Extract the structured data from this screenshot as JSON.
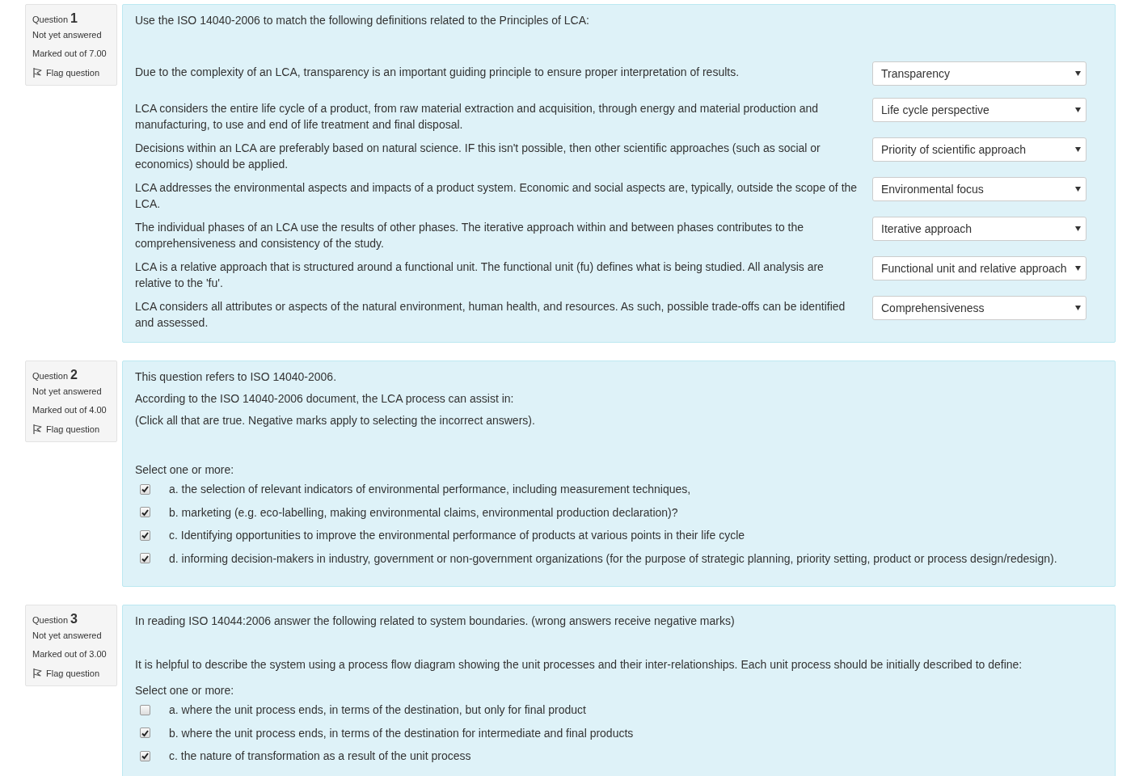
{
  "questions": [
    {
      "label": "Question",
      "number": "1",
      "status": "Not yet answered",
      "marks": "Marked out of 7.00",
      "flag": "Flag question",
      "kind": "match",
      "prompt": [
        "Use the ISO 14040-2006 to match the following definitions related to the Principles of LCA:"
      ],
      "rows": [
        {
          "text": "Due to the complexity of an LCA, transparency is an important guiding principle to ensure proper interpretation of results.",
          "answer": "Transparency"
        },
        {
          "text": "LCA considers the entire life cycle of a product, from raw material extraction and acquisition, through energy and material production and manufacturing, to use and end of life treatment and final disposal.",
          "answer": "Life cycle perspective"
        },
        {
          "text": "Decisions within an LCA are preferably based on natural science. IF this isn't possible, then other scientific approaches (such as social or economics) should be applied.",
          "answer": "Priority of scientific approach"
        },
        {
          "text": "LCA addresses the environmental aspects and impacts of a product system. Economic and social aspects are, typically, outside the scope of the LCA.",
          "answer": "Environmental focus"
        },
        {
          "text": "The individual phases of an LCA use the results of other phases. The iterative approach within and between phases contributes to the comprehensiveness and consistency of the study.",
          "answer": "Iterative approach"
        },
        {
          "text": "LCA is a relative approach that is structured around a functional unit. The functional unit (fu) defines what is being studied. All analysis are relative to the 'fu'.",
          "answer": "Functional unit and relative approach"
        },
        {
          "text": "LCA considers all attributes or aspects of the natural environment, human health, and resources. As such, possible trade-offs can be identified and assessed.",
          "answer": "Comprehensiveness"
        }
      ]
    },
    {
      "label": "Question",
      "number": "2",
      "status": "Not yet answered",
      "marks": "Marked out of 4.00",
      "flag": "Flag question",
      "kind": "multi",
      "prompt": [
        "This question refers to ISO 14040-2006.",
        "According to the ISO 14040-2006 document, the LCA process can assist in:",
        "(Click all that are true. Negative marks apply to selecting the incorrect answers)."
      ],
      "instruction": "Select one or more:",
      "options": [
        {
          "text": "a. the selection of relevant indicators of environmental performance, including measurement techniques,",
          "checked": true
        },
        {
          "text": "b. marketing (e.g. eco-labelling, making environmental claims, environmental production declaration)?",
          "checked": true
        },
        {
          "text": "c. Identifying opportunities to improve the environmental performance of products at various points in their life cycle",
          "checked": true
        },
        {
          "text": "d. informing decision-makers in industry, government or non-government organizations (for the purpose of strategic planning, priority setting, product or process design/redesign).",
          "checked": true
        }
      ]
    },
    {
      "label": "Question",
      "number": "3",
      "status": "Not yet answered",
      "marks": "Marked out of 3.00",
      "flag": "Flag question",
      "kind": "multi",
      "prompt": [
        "In reading ISO 14044:2006 answer the following related to system boundaries. (wrong answers receive negative marks)",
        "It is helpful to describe the system using a process flow diagram showing the unit processes and their inter-relationships. Each unit process should be initially described to define:"
      ],
      "instruction": "Select one or more:",
      "options": [
        {
          "text": "a. where the unit process ends, in terms of the destination, but only for final product",
          "checked": false
        },
        {
          "text": "b. where the unit process ends, in terms of the destination for intermediate and final products",
          "checked": true
        },
        {
          "text": "c. the nature of transformation as a result of the unit process",
          "checked": true
        }
      ]
    }
  ]
}
